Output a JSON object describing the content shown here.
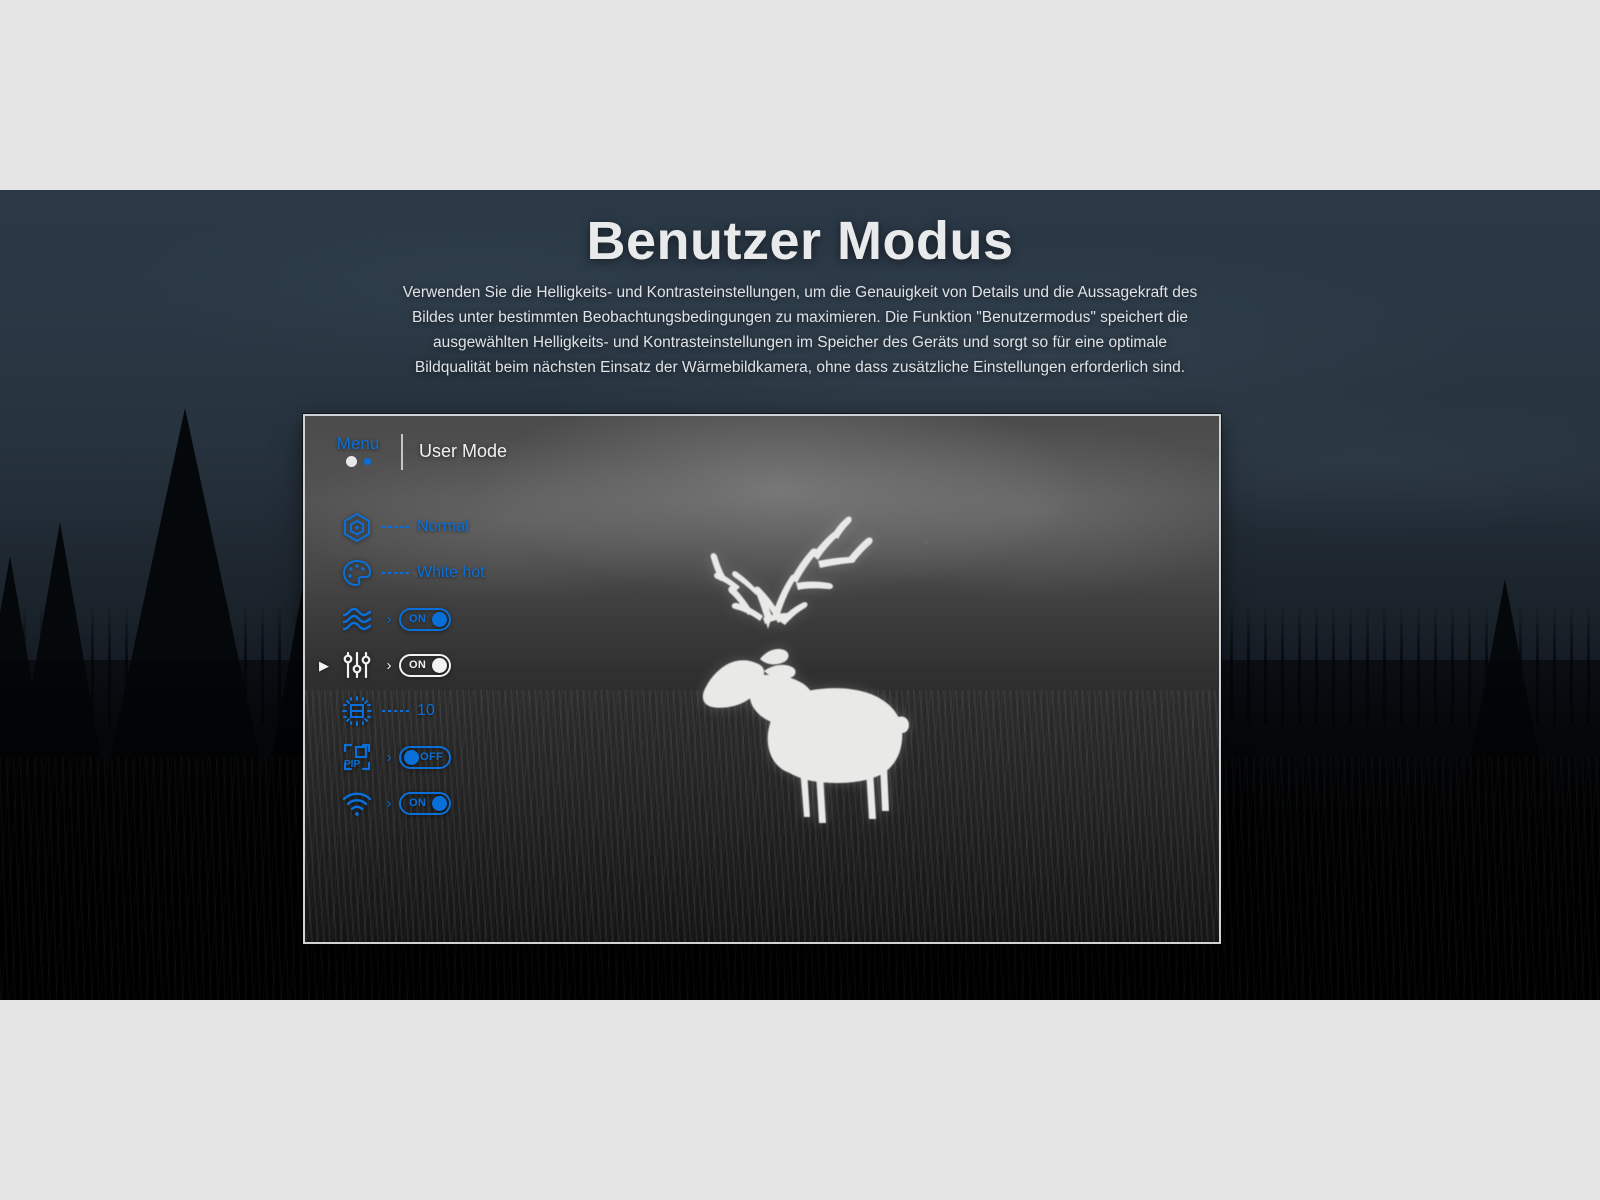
{
  "hero": {
    "title": "Benutzer Modus",
    "paragraph": "Verwenden Sie die Helligkeits- und Kontrasteinstellungen, um die Genauigkeit von Details und die Aussagekraft des Bildes unter bestimmten Beobachtungsbedingungen zu maximieren. Die Funktion \"Benutzermodus\" speichert die ausgewählten Helligkeits- und Kontrasteinstellungen im Speicher des Geräts und sorgt so für eine optimale Bildqualität beim nächsten Einsatz der Wärmebildkamera, ohne dass zusätzliche Einstellungen erforderlich sind."
  },
  "colors": {
    "accent_blue": "#0a6fd8",
    "selected_white": "#f2f2f2",
    "page_background": "#e4e4e4",
    "frame_border": "#cfd3d6"
  },
  "device": {
    "header": {
      "menu_label": "Menu",
      "dot_active": "white-dot",
      "dot_inactive": "blue-dot",
      "title": "User Mode"
    },
    "rows": [
      {
        "icon": "hexagon-mode-icon",
        "connector": "dotted",
        "value": "Normal",
        "control": "value",
        "selected": false
      },
      {
        "icon": "palette-icon",
        "connector": "dotted",
        "value": "White hot",
        "control": "value",
        "selected": false
      },
      {
        "icon": "wave-smoothing-icon",
        "connector": "chevron",
        "value": "ON",
        "control": "toggle-on",
        "selected": false
      },
      {
        "icon": "sliders-user-mode-icon",
        "connector": "chevron",
        "value": "ON",
        "control": "toggle-on",
        "selected": true
      },
      {
        "icon": "brightness-icon",
        "connector": "dotted",
        "value": "10",
        "control": "value",
        "selected": false
      },
      {
        "icon": "pip-icon",
        "connector": "chevron",
        "value": "OFF",
        "control": "toggle-off",
        "selected": false
      },
      {
        "icon": "wifi-icon",
        "connector": "chevron",
        "value": "ON",
        "control": "toggle-on",
        "selected": false
      }
    ],
    "scene": "white-hot-thermal-deer"
  }
}
